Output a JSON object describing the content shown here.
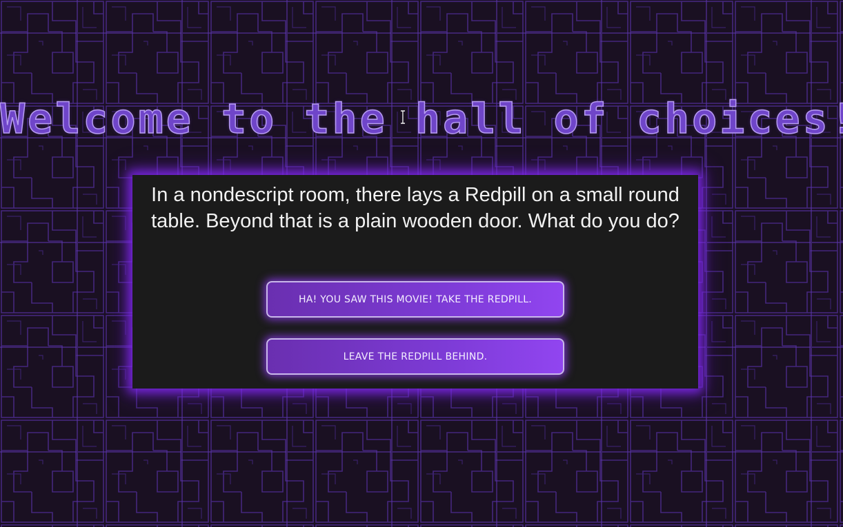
{
  "page": {
    "title": "Welcome to the hall of choices!"
  },
  "scene": {
    "prompt": "In a nondescript room, there lays a Redpill on a small round table. Beyond that is a plain wooden door. What do you do?",
    "choices": [
      {
        "label": "HA! YOU SAW THIS MOVIE! TAKE THE REDPILL."
      },
      {
        "label": "LEAVE THE REDPILL BEHIND."
      }
    ]
  },
  "theme": {
    "background": "#1a1022",
    "pattern_color": "#4a2a8c",
    "title_color": "#6f45c9",
    "panel_background": "#1b1b1b",
    "glow_color": "#8a2be2",
    "button_gradient_start": "#6a2fb0",
    "button_gradient_end": "#9145f0"
  },
  "cursor": {
    "icon": "text-cursor-icon"
  }
}
